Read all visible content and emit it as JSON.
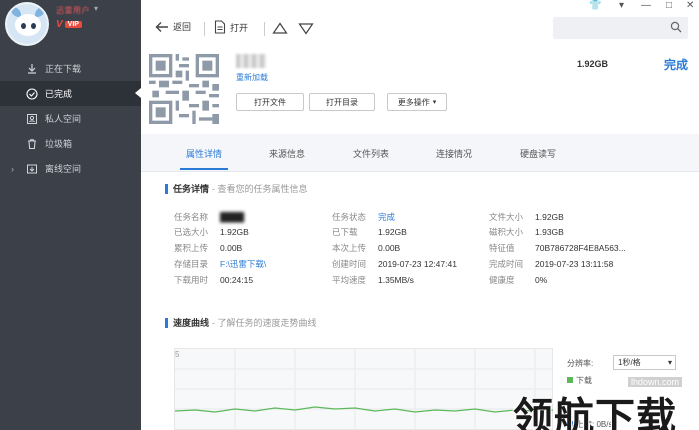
{
  "user": {
    "name": "迅雷用户",
    "vip_label": "VIP",
    "vip_mark": "V"
  },
  "sidebar": {
    "items": [
      {
        "label": "正在下载",
        "icon": "download-icon"
      },
      {
        "label": "已完成",
        "icon": "check-circle-icon"
      },
      {
        "label": "私人空间",
        "icon": "person-icon"
      },
      {
        "label": "垃圾箱",
        "icon": "trash-icon"
      },
      {
        "label": "离线空间",
        "icon": "cloud-icon"
      }
    ]
  },
  "toolbar": {
    "back_label": "返回",
    "open_label": "打开",
    "search_placeholder": ""
  },
  "task": {
    "reload_label": "重新加载",
    "open_file_label": "打开文件",
    "open_dir_label": "打开目录",
    "more_label": "更多操作",
    "size": "1.92GB",
    "status": "完成"
  },
  "tabs": [
    "属性详情",
    "来源信息",
    "文件列表",
    "连接情况",
    "硬盘读写"
  ],
  "details": {
    "title": "任务详情",
    "subtitle": "- 查看您的任务属性信息",
    "col1": [
      {
        "k": "任务名称",
        "v": "████"
      },
      {
        "k": "已选大小",
        "v": "1.92GB"
      },
      {
        "k": "累积上传",
        "v": "0.00B"
      },
      {
        "k": "存储目录",
        "v": "F:\\迅雷下载\\"
      },
      {
        "k": "下载用时",
        "v": "00:24:15"
      }
    ],
    "col2": [
      {
        "k": "任务状态",
        "v": "完成"
      },
      {
        "k": "已下载",
        "v": "1.92GB"
      },
      {
        "k": "本次上传",
        "v": "0.00B"
      },
      {
        "k": "创建时间",
        "v": "2019-07-23 12:47:41"
      },
      {
        "k": "平均速度",
        "v": "1.35MB/s"
      }
    ],
    "col3": [
      {
        "k": "文件大小",
        "v": "1.92GB"
      },
      {
        "k": "磁积大小",
        "v": "1.93GB"
      },
      {
        "k": "特征值",
        "v": "70B786728F4E8A563..."
      },
      {
        "k": "完成时间",
        "v": "2019-07-23 13:11:58"
      },
      {
        "k": "健康度",
        "v": "0%"
      }
    ]
  },
  "speed": {
    "title": "速度曲线",
    "subtitle": "- 了解任务的速度走势曲线",
    "y_top": "5",
    "interval_label": "分辨率:",
    "interval_value": "1秒/格",
    "download_label": "下载",
    "upload_label": "上传: 0B/s",
    "colors": {
      "download": "#5cb85c",
      "upload": "#2b7bd6"
    }
  },
  "watermark": {
    "site": "lhdown.com",
    "text": "领航下载"
  }
}
